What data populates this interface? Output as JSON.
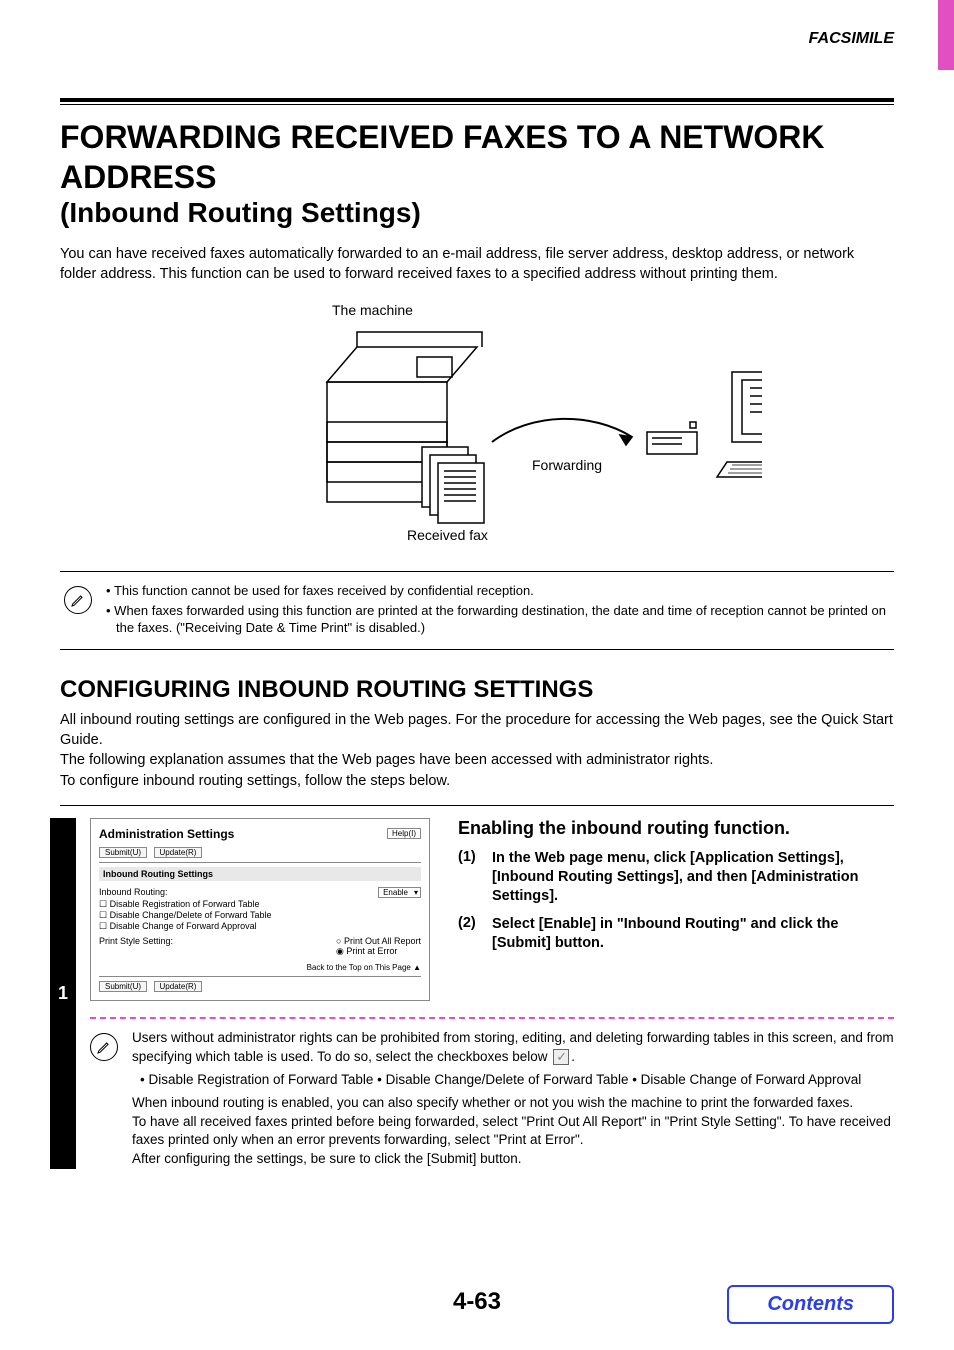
{
  "section_label": "FACSIMILE",
  "title_line1": "FORWARDING RECEIVED FAXES TO A NETWORK ADDRESS",
  "title_line2": "(Inbound Routing Settings)",
  "intro": "You can have received faxes automatically forwarded to an e-mail address, file server address, desktop address, or network folder address. This function can be used to forward received faxes to a specified address without printing them.",
  "diagram": {
    "machine_caption": "The machine",
    "forwarding_caption": "Forwarding",
    "received_caption": "Received fax"
  },
  "top_notes": [
    "This function cannot be used for faxes received by confidential reception.",
    "When faxes forwarded using this function are printed at the forwarding destination, the date and time of reception cannot be printed on the faxes. (\"Receiving Date & Time Print\" is disabled.)"
  ],
  "h2": "CONFIGURING INBOUND ROUTING SETTINGS",
  "config_intro_1": "All inbound routing settings are configured in the Web pages. For the procedure for accessing the Web pages, see the Quick Start Guide.",
  "config_intro_2": "The following explanation assumes that the Web pages have been accessed with administrator rights.",
  "config_intro_3": "To configure inbound routing settings, follow the steps below.",
  "step_number": "1",
  "webpanel": {
    "title": "Administration Settings",
    "help": "Help(I)",
    "submit": "Submit(U)",
    "update": "Update(R)",
    "bar": "Inbound Routing Settings",
    "row_inbound": "Inbound Routing:",
    "enable": "Enable",
    "chk1": "Disable Registration of Forward Table",
    "chk2": "Disable Change/Delete of Forward Table",
    "chk3": "Disable Change of Forward Approval",
    "row_print": "Print Style Setting:",
    "radio1": "Print Out All Report",
    "radio2": "Print at Error",
    "back": "Back to the Top on This Page ▲"
  },
  "step_head": "Enabling the inbound routing function.",
  "steps": [
    {
      "n": "(1)",
      "t": "In the Web page menu, click [Application Settings], [Inbound Routing Settings], and then [Administration Settings]."
    },
    {
      "n": "(2)",
      "t": "Select [Enable] in \"Inbound Routing\" and click the [Submit] button."
    }
  ],
  "lower": {
    "p1a": "Users without administrator rights can be prohibited from storing, editing, and deleting forwarding tables in this screen, and from specifying which table is used. To do so, select the checkboxes below ",
    "p1b": ".",
    "opts": "• Disable Registration of Forward Table   • Disable Change/Delete of Forward Table   • Disable Change of Forward Approval",
    "p2": "When inbound routing is enabled, you can also specify whether or not you wish the machine to print the forwarded faxes.",
    "p3": "To have all received faxes printed before being forwarded, select \"Print Out All Report\" in \"Print Style Setting\". To have received faxes printed only when an error prevents forwarding, select \"Print at Error\".",
    "p4": "After configuring the settings, be sure to click the [Submit] button."
  },
  "page_num": "4-63",
  "contents": "Contents"
}
